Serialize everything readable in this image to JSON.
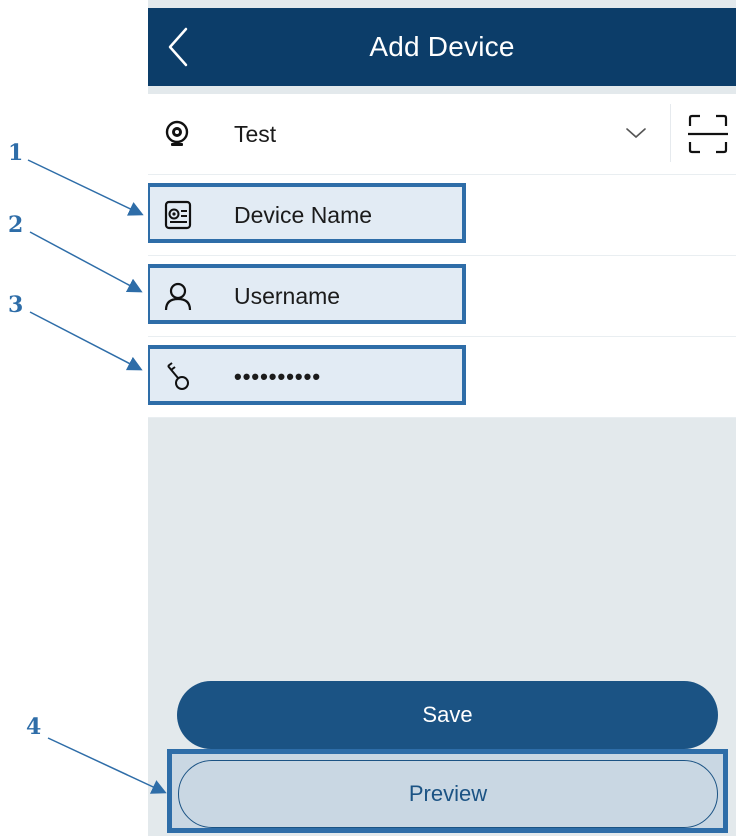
{
  "header": {
    "title": "Add Device",
    "back_icon": "chevron-left-icon"
  },
  "form": {
    "device_type": {
      "icon": "webcam-icon",
      "value": "Test",
      "dropdown_icon": "chevron-down-icon",
      "scan_icon": "scan-icon"
    },
    "device_name": {
      "icon": "camera-id-icon",
      "placeholder": "Device Name"
    },
    "username": {
      "icon": "user-icon",
      "placeholder": "Username"
    },
    "password": {
      "icon": "key-icon",
      "value": "••••••••••"
    }
  },
  "buttons": {
    "save_label": "Save",
    "preview_label": "Preview"
  },
  "annotations": [
    {
      "number": "1",
      "target": "device-name-field"
    },
    {
      "number": "2",
      "target": "username-field"
    },
    {
      "number": "3",
      "target": "password-field"
    },
    {
      "number": "4",
      "target": "preview-button"
    }
  ],
  "colors": {
    "header": "#0c3d69",
    "accent": "#1b5384",
    "highlight": "#2e6da8",
    "background": "#e3e9ec"
  }
}
